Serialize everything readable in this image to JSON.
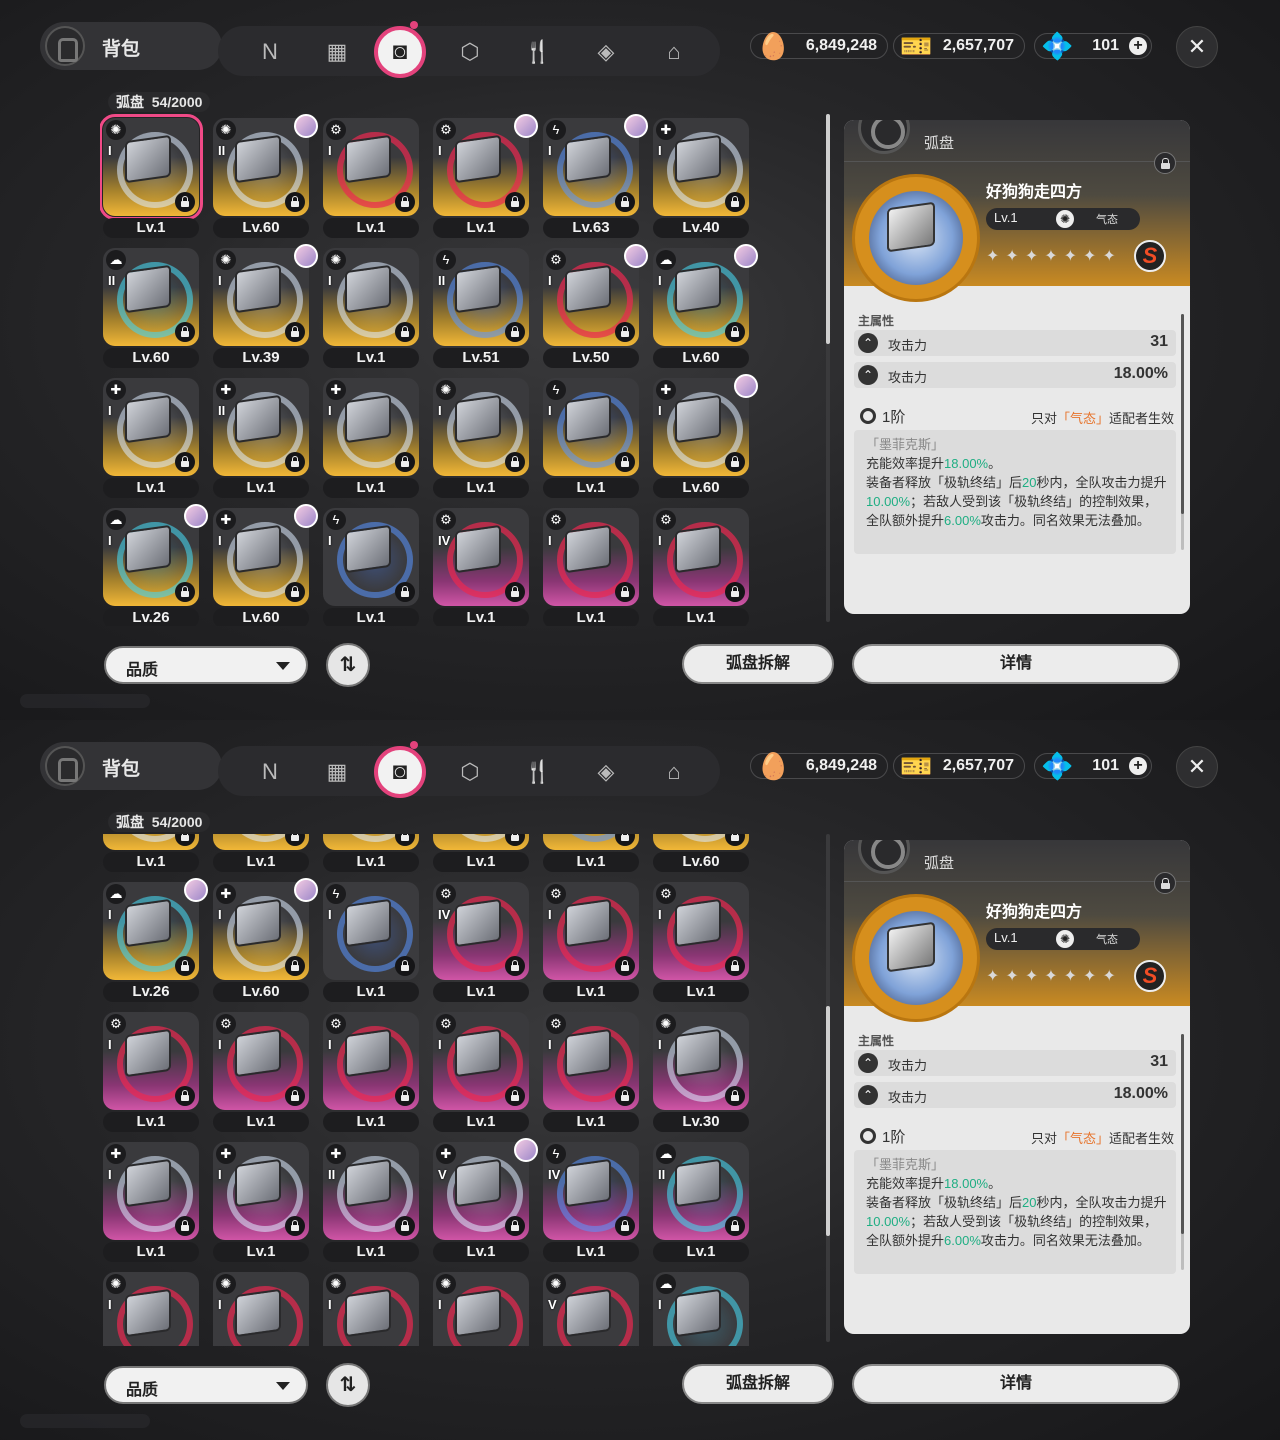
{
  "header": {
    "bag_title": "背包",
    "categories": [
      {
        "icon": "n-logo-icon",
        "glyph": "N",
        "active": false
      },
      {
        "icon": "gameboy-icon",
        "glyph": "▦",
        "active": false
      },
      {
        "icon": "disc-icon",
        "glyph": "◙",
        "active": true
      },
      {
        "icon": "cube-icon",
        "glyph": "⬡",
        "active": false
      },
      {
        "icon": "fork-knife-icon",
        "glyph": "🍴",
        "active": false
      },
      {
        "icon": "package-icon",
        "glyph": "◈",
        "active": false
      },
      {
        "icon": "home-icon",
        "glyph": "⌂",
        "active": false
      }
    ],
    "currencies": [
      {
        "icon": "gold-egg-icon",
        "glyph": "🥚",
        "value": "6,849,248"
      },
      {
        "icon": "ticket-icon",
        "glyph": "🎫",
        "value": "2,657,707"
      },
      {
        "icon": "blue-crystal-icon",
        "glyph": "💠",
        "value": "101",
        "has_plus": true
      }
    ],
    "close_symbol": "✕"
  },
  "inventory": {
    "label": "弧盘",
    "count": "54/2000",
    "grid_top": [
      [
        {
          "lv": "Lv.1",
          "rank": "I",
          "attr": "swirl",
          "q": "gold",
          "sel": true
        },
        {
          "lv": "Lv.60",
          "rank": "II",
          "attr": "swirl",
          "q": "gold",
          "avatar": true
        },
        {
          "lv": "Lv.1",
          "rank": "I",
          "attr": "gear",
          "q": "gold",
          "swirl": "red"
        },
        {
          "lv": "Lv.1",
          "rank": "I",
          "attr": "gear",
          "q": "gold",
          "avatar": true,
          "swirl": "red"
        },
        {
          "lv": "Lv.63",
          "rank": "I",
          "attr": "bolt",
          "q": "gold",
          "avatar": true,
          "swirl": "blue"
        },
        {
          "lv": "Lv.40",
          "rank": "I",
          "attr": "cross",
          "q": "gold",
          "swirl": "white"
        }
      ],
      [
        {
          "lv": "Lv.60",
          "rank": "II",
          "attr": "wind",
          "q": "gold",
          "swirl": "cyan"
        },
        {
          "lv": "Lv.39",
          "rank": "I",
          "attr": "swirl",
          "q": "gold",
          "avatar": true
        },
        {
          "lv": "Lv.1",
          "rank": "I",
          "attr": "swirl",
          "q": "gold"
        },
        {
          "lv": "Lv.51",
          "rank": "II",
          "attr": "bolt",
          "q": "gold",
          "swirl": "blue"
        },
        {
          "lv": "Lv.50",
          "rank": "I",
          "attr": "gear",
          "q": "gold",
          "avatar": true,
          "swirl": "red"
        },
        {
          "lv": "Lv.60",
          "rank": "I",
          "attr": "wind",
          "q": "gold",
          "avatar": true,
          "swirl": "cyan"
        }
      ],
      [
        {
          "lv": "Lv.1",
          "rank": "I",
          "attr": "cross",
          "q": "gold",
          "swirl": "white"
        },
        {
          "lv": "Lv.1",
          "rank": "II",
          "attr": "cross",
          "q": "gold",
          "swirl": "white"
        },
        {
          "lv": "Lv.1",
          "rank": "I",
          "attr": "cross",
          "q": "gold",
          "swirl": "white"
        },
        {
          "lv": "Lv.1",
          "rank": "I",
          "attr": "swirl",
          "q": "gold"
        },
        {
          "lv": "Lv.1",
          "rank": "I",
          "attr": "bolt",
          "q": "gold",
          "swirl": "blue"
        },
        {
          "lv": "Lv.60",
          "rank": "I",
          "attr": "cross",
          "q": "gold",
          "avatar": true,
          "swirl": "white"
        }
      ],
      [
        {
          "lv": "Lv.26",
          "rank": "I",
          "attr": "wind",
          "q": "gold",
          "avatar": true,
          "swirl": "cyan"
        },
        {
          "lv": "Lv.60",
          "rank": "I",
          "attr": "cross",
          "q": "gold",
          "avatar": true,
          "swirl": "white"
        },
        {
          "lv": "Lv.1",
          "rank": "I",
          "attr": "bolt",
          "q": "none",
          "swirl": "blue"
        },
        {
          "lv": "Lv.1",
          "rank": "IV",
          "attr": "gear",
          "q": "pink",
          "swirl": "red"
        },
        {
          "lv": "Lv.1",
          "rank": "I",
          "attr": "gear",
          "q": "pink",
          "swirl": "red"
        },
        {
          "lv": "Lv.1",
          "rank": "I",
          "attr": "gear",
          "q": "pink",
          "swirl": "red"
        }
      ]
    ],
    "grid_bottom": [
      [
        {
          "lv": "Lv.1",
          "rank": "",
          "attr": "",
          "q": "gold",
          "swirl": "white"
        },
        {
          "lv": "Lv.1",
          "rank": "",
          "attr": "",
          "q": "gold",
          "swirl": "white"
        },
        {
          "lv": "Lv.1",
          "rank": "",
          "attr": "",
          "q": "gold",
          "swirl": "white"
        },
        {
          "lv": "Lv.1",
          "rank": "",
          "attr": "",
          "q": "gold"
        },
        {
          "lv": "Lv.1",
          "rank": "",
          "attr": "",
          "q": "gold",
          "swirl": "blue"
        },
        {
          "lv": "Lv.60",
          "rank": "",
          "attr": "",
          "q": "gold",
          "swirl": "white"
        }
      ],
      [
        {
          "lv": "Lv.26",
          "rank": "I",
          "attr": "wind",
          "q": "gold",
          "avatar": true,
          "swirl": "cyan"
        },
        {
          "lv": "Lv.60",
          "rank": "I",
          "attr": "cross",
          "q": "gold",
          "avatar": true,
          "swirl": "white"
        },
        {
          "lv": "Lv.1",
          "rank": "I",
          "attr": "bolt",
          "q": "none",
          "swirl": "blue"
        },
        {
          "lv": "Lv.1",
          "rank": "IV",
          "attr": "gear",
          "q": "pink",
          "swirl": "red"
        },
        {
          "lv": "Lv.1",
          "rank": "I",
          "attr": "gear",
          "q": "pink",
          "swirl": "red"
        },
        {
          "lv": "Lv.1",
          "rank": "I",
          "attr": "gear",
          "q": "pink",
          "swirl": "red"
        }
      ],
      [
        {
          "lv": "Lv.1",
          "rank": "I",
          "attr": "gear",
          "q": "pink",
          "swirl": "red"
        },
        {
          "lv": "Lv.1",
          "rank": "I",
          "attr": "gear",
          "q": "pink",
          "swirl": "red"
        },
        {
          "lv": "Lv.1",
          "rank": "I",
          "attr": "gear",
          "q": "pink",
          "swirl": "red"
        },
        {
          "lv": "Lv.1",
          "rank": "I",
          "attr": "gear",
          "q": "pink",
          "swirl": "red"
        },
        {
          "lv": "Lv.1",
          "rank": "I",
          "attr": "gear",
          "q": "pink",
          "swirl": "red"
        },
        {
          "lv": "Lv.30",
          "rank": "I",
          "attr": "swirl",
          "q": "pink",
          "swirl": "white"
        }
      ],
      [
        {
          "lv": "Lv.1",
          "rank": "I",
          "attr": "cross",
          "q": "pink",
          "swirl": "white"
        },
        {
          "lv": "Lv.1",
          "rank": "I",
          "attr": "cross",
          "q": "pink",
          "swirl": "white"
        },
        {
          "lv": "Lv.1",
          "rank": "II",
          "attr": "cross",
          "q": "pink",
          "swirl": "white"
        },
        {
          "lv": "Lv.1",
          "rank": "V",
          "attr": "cross",
          "q": "pink",
          "avatar": true,
          "swirl": "white"
        },
        {
          "lv": "Lv.1",
          "rank": "IV",
          "attr": "bolt",
          "q": "pink",
          "swirl": "blue"
        },
        {
          "lv": "Lv.1",
          "rank": "II",
          "attr": "wind",
          "q": "pink",
          "swirl": "cyan"
        }
      ],
      [
        {
          "lv": "",
          "rank": "I",
          "attr": "swirl",
          "q": "none",
          "swirl": "red"
        },
        {
          "lv": "",
          "rank": "I",
          "attr": "swirl",
          "q": "none",
          "swirl": "red"
        },
        {
          "lv": "",
          "rank": "I",
          "attr": "swirl",
          "q": "none",
          "swirl": "red"
        },
        {
          "lv": "",
          "rank": "I",
          "attr": "swirl",
          "q": "none",
          "swirl": "red"
        },
        {
          "lv": "",
          "rank": "V",
          "attr": "swirl",
          "q": "none",
          "swirl": "red"
        },
        {
          "lv": "",
          "rank": "I",
          "attr": "wind",
          "q": "none",
          "swirl": "cyan"
        }
      ]
    ],
    "scroll_position_top": 0.0,
    "scroll_position_bottom": 0.62
  },
  "detail": {
    "category": "弧盘",
    "name": "好狗狗走四方",
    "level": "Lv.1",
    "attribute_type": "气态",
    "attribute_glyph": "✺",
    "stars": "✦✦✦✦✦✦✦",
    "rank": "S",
    "main_label": "主属性",
    "stats": [
      {
        "name": "攻击力",
        "value": "31"
      },
      {
        "name": "攻击力",
        "value": "18.00%"
      }
    ],
    "set_tier": "1阶",
    "set_cond_pre": "只对",
    "set_cond_hl": "「气态」",
    "set_cond_post": "适配者生效",
    "set_name": "「墨菲克斯」",
    "desc": {
      "l1a": "充能效率提升",
      "l1b": "18.00%",
      "l1c": "。",
      "l2a": "装备者释放「极轨终结」后",
      "l2b": "20",
      "l2c": "秒内，全队攻击力提升",
      "l2d": "10.00%",
      "l2e": "；若敌人受到该「极轨终结」的控制效果，全队额外提升",
      "l2f": "6.00%",
      "l2g": "攻击力。同名效果无法叠加。"
    }
  },
  "footer": {
    "filter_label": "品质",
    "sort_glyph": "⇅",
    "dismantle_label": "弧盘拆解",
    "details_label": "详情"
  },
  "colors": {
    "accent_pink": "#e3427c",
    "gold_quality": "#f1b737",
    "pink_quality": "#d055a6",
    "highlight_green": "#1fae83",
    "highlight_orange": "#e7742c"
  }
}
